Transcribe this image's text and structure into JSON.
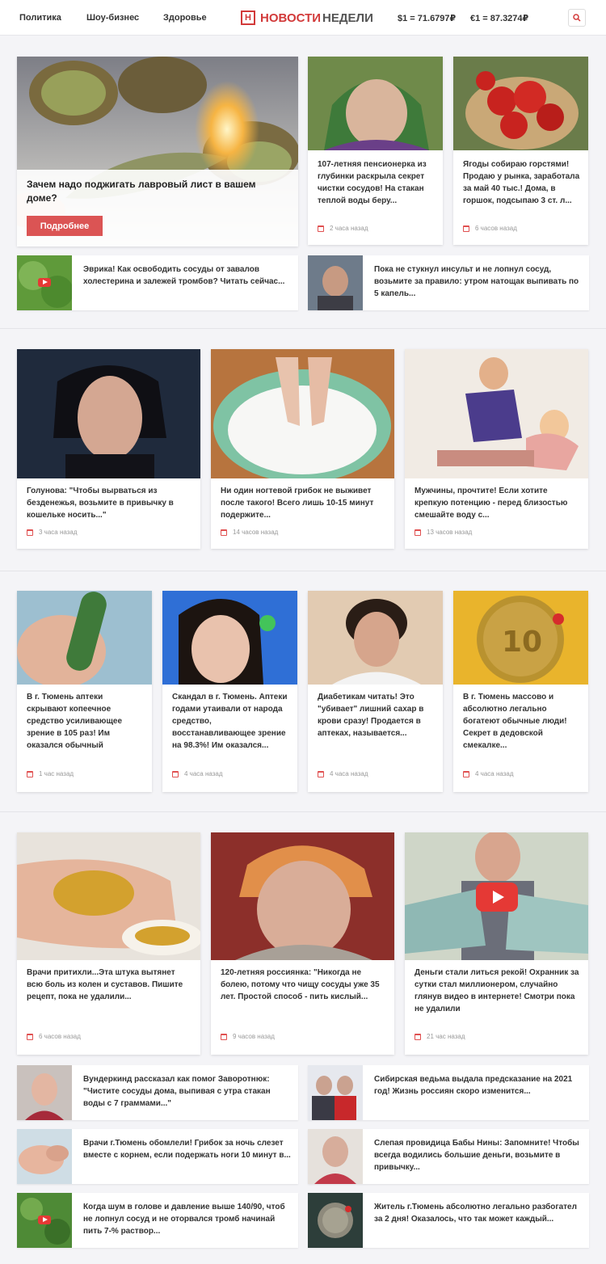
{
  "header": {
    "nav": [
      "Политика",
      "Шоу-бизнес",
      "Здоровье"
    ],
    "logo_mark": "Н",
    "logo_part1": "НОВОСТИ",
    "logo_part2": "НЕДЕЛИ",
    "rate_usd": "$1 = 71.6797₽",
    "rate_eur": "€1 = 87.3274₽",
    "search_icon": "search-icon"
  },
  "hero": {
    "title": "Зачем надо поджигать лавровый лист в вашем доме?",
    "button": "Подробнее"
  },
  "top_cards": [
    {
      "title": "107-летняя пенсионерка из глубинки раскрыла секрет чистки сосудов! На стакан теплой воды беру...",
      "time": "2 часа назад"
    },
    {
      "title": "Ягоды собираю горстями! Продаю у рынка, заработала за май 40 тыс.! Дома, в горшок, подсыпаю 3 ст. л...",
      "time": "6 часов назад"
    }
  ],
  "top_rows": [
    {
      "text": "Эврика! Как освободить сосуды от завалов холестерина и залежей тромбов? Читать сейчас..."
    },
    {
      "text": "Пока не стукнул инсульт и не лопнул сосуд, возьмите за правило: утром натощак выпивать по 5 капель..."
    }
  ],
  "section2": [
    {
      "title": "Голунова: \"Чтобы вырваться из безденежья, возьмите в привычку в кошельке носить...\"",
      "time": "3 часа назад"
    },
    {
      "title": "Ни один ногтевой грибок не выживет после такого! Всего лишь 10-15 минут подержите...",
      "time": "14 часов назад"
    },
    {
      "title": "Мужчины, прочтите! Если хотите крепкую потенцию - перед близостью смешайте воду с...",
      "time": "13 часов назад"
    }
  ],
  "section3": [
    {
      "title": "В г. Тюмень аптеки скрывают копеечное средство усиливающее зрение в 105 раз! Им оказался обычный",
      "time": "1 час назад"
    },
    {
      "title": "Скандал в г. Тюмень. Аптеки годами утаивали от народа средство, восстанавливающее зрение на 98.3%! Им оказался...",
      "time": "4 часа назад"
    },
    {
      "title": "Диабетикам читать! Это \"убивает\" лишний сахар в крови сразу! Продается в аптеках, называется...",
      "time": "4 часа назад"
    },
    {
      "title": "В г. Тюмень массово и абсолютно легально богатеют обычные люди! Секрет в дедовской смекалке...",
      "time": "4 часа назад"
    }
  ],
  "section4": [
    {
      "title": "Врачи притихли...Эта штука вытянет всю боль из колен и суставов. Пишите рецепт, пока не удалили...",
      "time": "6 часов назад"
    },
    {
      "title": "120-летняя россиянка: \"Никогда не болею, потому что чищу сосуды уже 35 лет. Простой способ - пить кислый...",
      "time": "9 часов назад"
    },
    {
      "title": "Деньги стали литься рекой! Охранник за сутки стал миллионером, случайно глянув видео в интернете! Смотри пока не удалили",
      "time": "21 час назад"
    }
  ],
  "bottom_rows": [
    {
      "text": "Вундеркинд рассказал как помог Заворотнюк: \"Чистите сосуды дома, выпивая с утра стакан воды с 7 граммами...\""
    },
    {
      "text": "Сибирская ведьма выдала предсказание на 2021 год! Жизнь россиян скоро изменится..."
    },
    {
      "text": "Врачи г.Тюмень обомлели! Грибок за ночь слезет вместе с корнем, если подержать ноги 10 минут в..."
    },
    {
      "text": "Слепая провидица Бабы Нины: Запомните! Чтобы всегда водились большие деньги, возьмите в привычку..."
    },
    {
      "text": "Когда шум в голове и давление выше 140/90, чтоб не лопнул сосуд и не оторвался тромб начинай пить 7-% раствор..."
    },
    {
      "text": "Житель г.Тюмень абсолютно легально разбогател за 2 дня! Оказалось, что так может каждый..."
    }
  ],
  "colors": {
    "accent": "#d23a3a",
    "button": "#db5454",
    "background": "#f4f4f7"
  }
}
